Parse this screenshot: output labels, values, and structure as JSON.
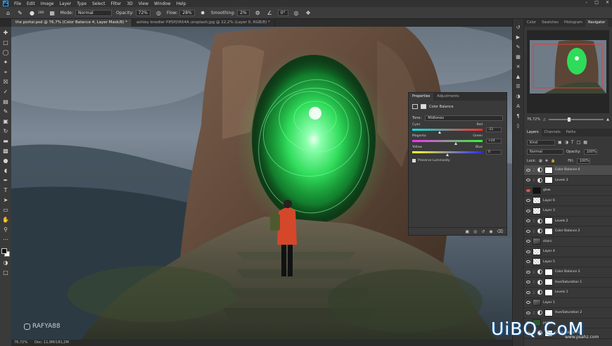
{
  "menubar": {
    "logo": "Ps",
    "items": [
      "File",
      "Edit",
      "Image",
      "Layer",
      "Type",
      "Select",
      "Filter",
      "3D",
      "View",
      "Window",
      "Help"
    ]
  },
  "options": {
    "size": "280",
    "mode_label": "Mode:",
    "mode_value": "Normal",
    "opacity_label": "Opacity:",
    "opacity_value": "72%",
    "flow_label": "Flow:",
    "flow_value": "28%",
    "smoothing_label": "Smoothing:",
    "smoothing_value": "2%",
    "angle_value": "0°"
  },
  "tabs": [
    "the portal.psd @ 76,7% (Color Balance 4, Layer Mask/8) *",
    "ashley knedler PIfSPjYA54A unsplash.jpg @ 22,2% (Layer 0, RGB/8) *"
  ],
  "status": {
    "zoom": "76,72%",
    "doc": "Doc: 11,9M/181,2M"
  },
  "watermark": "RAFYA88",
  "properties": {
    "tab_properties": "Properties",
    "tab_adjustments": "Adjustments",
    "title": "Color Balance",
    "tone_label": "Tone:",
    "tone_value": "Midtones",
    "sliders": [
      {
        "left": "Cyan",
        "right": "Red",
        "value": "-21",
        "level": -21
      },
      {
        "left": "Magenta",
        "right": "Green",
        "value": "+24",
        "level": 24
      },
      {
        "left": "Yellow",
        "right": "Blue",
        "value": "0",
        "level": 0
      }
    ],
    "preserve_label": "Preserve Luminosity"
  },
  "navigator": {
    "tabs": [
      "Color",
      "Swatches",
      "Histogram",
      "Navigator"
    ],
    "zoom": "76,72%"
  },
  "layers_panel": {
    "tabs": [
      "Layers",
      "Channels",
      "Paths"
    ],
    "filter_label": "Kind",
    "blend_mode": "Normal",
    "opacity_label": "Opacity:",
    "opacity_value": "100%",
    "lock_label": "Lock:",
    "fill_label": "Fill:",
    "fill_value": "100%",
    "layers": [
      {
        "name": "Color Balance 4",
        "kind": "adj",
        "thumb": "mask",
        "selected": true,
        "eye": "on"
      },
      {
        "name": "Levels 3",
        "kind": "adj",
        "thumb": "mask",
        "selected": false,
        "eye": "on"
      },
      {
        "name": "glow",
        "kind": "pixel",
        "thumb": "dark",
        "selected": false,
        "eye": "red"
      },
      {
        "name": "Layer 6",
        "kind": "pixel",
        "thumb": "checker",
        "selected": false,
        "eye": "on"
      },
      {
        "name": "Layer 3",
        "kind": "pixel",
        "thumb": "checker",
        "selected": false,
        "eye": "on"
      },
      {
        "name": "Levels 2",
        "kind": "adj",
        "thumb": "mask",
        "selected": false,
        "eye": "on"
      },
      {
        "name": "Color Balance 2",
        "kind": "adj",
        "thumb": "mask",
        "selected": false,
        "eye": "on"
      },
      {
        "name": "stairs",
        "kind": "pixel",
        "thumb": "img",
        "selected": false,
        "eye": "on"
      },
      {
        "name": "Layer 4",
        "kind": "pixel",
        "thumb": "checker",
        "selected": false,
        "eye": "on"
      },
      {
        "name": "Layer 5",
        "kind": "pixel",
        "thumb": "checker",
        "selected": false,
        "eye": "on"
      },
      {
        "name": "Color Balance 3",
        "kind": "adj",
        "thumb": "mask",
        "selected": false,
        "eye": "on"
      },
      {
        "name": "Hue/Saturation 1",
        "kind": "adj",
        "thumb": "mask",
        "selected": false,
        "eye": "on"
      },
      {
        "name": "Levels 1",
        "kind": "adj",
        "thumb": "mask",
        "selected": false,
        "eye": "on"
      },
      {
        "name": "Layer 1",
        "kind": "pixel",
        "thumb": "img",
        "selected": false,
        "eye": "on"
      },
      {
        "name": "Hue/Saturation 2",
        "kind": "adj",
        "thumb": "mask",
        "selected": false,
        "eye": "on"
      },
      {
        "name": "portal",
        "kind": "pixel",
        "thumb": "green",
        "selected": false,
        "eye": "on"
      },
      {
        "name": "Color Balance 1",
        "kind": "adj",
        "thumb": "mask",
        "selected": false,
        "eye": "on"
      }
    ]
  },
  "site_watermark": "UiBQ.CoM",
  "site_watermark_sub": "www.psahz.com",
  "colors": {
    "accent": "#31a8ff",
    "glow": "#3dff6a",
    "selected_layer": "#4d4d4d"
  }
}
